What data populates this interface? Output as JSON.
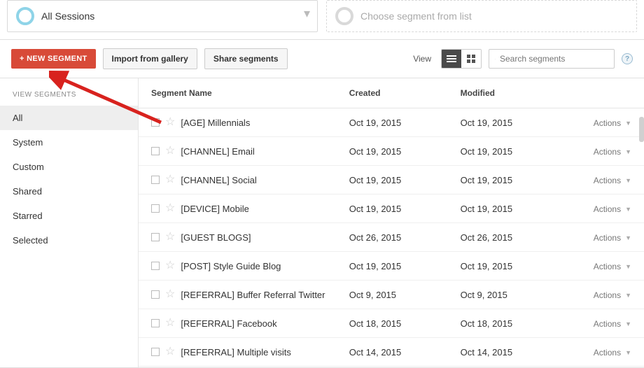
{
  "segments": {
    "selected_label": "All Sessions",
    "placeholder_label": "Choose segment from list"
  },
  "toolbar": {
    "new_segment": "+ NEW SEGMENT",
    "import": "Import from gallery",
    "share": "Share segments",
    "view_label": "View",
    "search_placeholder": "Search segments"
  },
  "sidebar": {
    "title": "VIEW SEGMENTS",
    "items": [
      "All",
      "System",
      "Custom",
      "Shared",
      "Starred",
      "Selected"
    ],
    "active_index": 0
  },
  "table": {
    "columns": {
      "name": "Segment Name",
      "created": "Created",
      "modified": "Modified"
    },
    "actions_label": "Actions",
    "rows": [
      {
        "name": "[AGE] Millennials",
        "created": "Oct 19, 2015",
        "modified": "Oct 19, 2015"
      },
      {
        "name": "[CHANNEL] Email",
        "created": "Oct 19, 2015",
        "modified": "Oct 19, 2015"
      },
      {
        "name": "[CHANNEL] Social",
        "created": "Oct 19, 2015",
        "modified": "Oct 19, 2015"
      },
      {
        "name": "[DEVICE] Mobile",
        "created": "Oct 19, 2015",
        "modified": "Oct 19, 2015"
      },
      {
        "name": "[GUEST BLOGS]",
        "created": "Oct 26, 2015",
        "modified": "Oct 26, 2015"
      },
      {
        "name": "[POST] Style Guide Blog",
        "created": "Oct 19, 2015",
        "modified": "Oct 19, 2015"
      },
      {
        "name": "[REFERRAL] Buffer Referral Twitter",
        "created": "Oct 9, 2015",
        "modified": "Oct 9, 2015"
      },
      {
        "name": "[REFERRAL] Facebook",
        "created": "Oct 18, 2015",
        "modified": "Oct 18, 2015"
      },
      {
        "name": "[REFERRAL] Multiple visits",
        "created": "Oct 14, 2015",
        "modified": "Oct 14, 2015"
      }
    ]
  }
}
